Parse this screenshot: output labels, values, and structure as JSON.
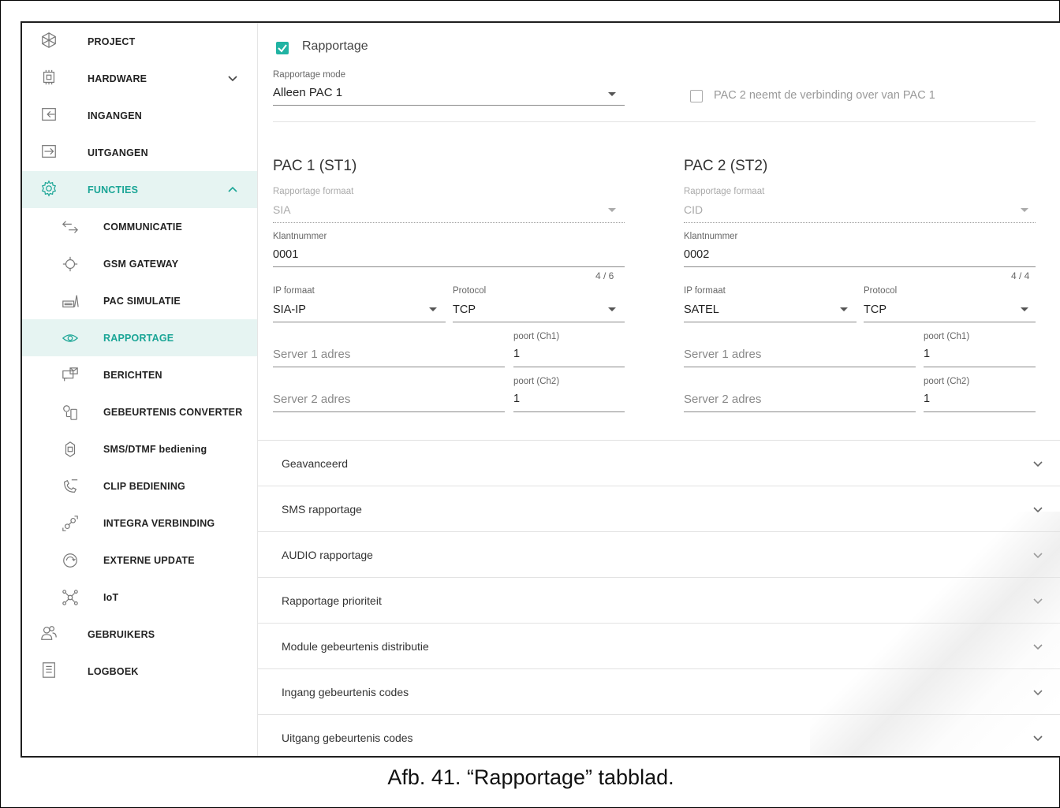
{
  "sidebar": {
    "items": [
      {
        "label": "PROJECT",
        "icon": "project-icon"
      },
      {
        "label": "HARDWARE",
        "icon": "hardware-icon",
        "chevron": "down"
      },
      {
        "label": "INGANGEN",
        "icon": "inputs-icon"
      },
      {
        "label": "UITGANGEN",
        "icon": "outputs-icon"
      },
      {
        "label": "FUNCTIES",
        "icon": "gear-icon",
        "chevron": "up"
      },
      {
        "label": "COMMUNICATIE",
        "icon": "communication-icon"
      },
      {
        "label": "GSM GATEWAY",
        "icon": "gsm-gateway-icon"
      },
      {
        "label": "PAC SIMULATIE",
        "icon": "pac-simulation-icon"
      },
      {
        "label": "RAPPORTAGE",
        "icon": "eye-icon"
      },
      {
        "label": "BERICHTEN",
        "icon": "messages-icon"
      },
      {
        "label": "GEBEURTENIS CONVERTER",
        "icon": "event-converter-icon"
      },
      {
        "label": "SMS/DTMF bediening",
        "icon": "sms-dtmf-icon"
      },
      {
        "label": "CLIP BEDIENING",
        "icon": "clip-phone-icon"
      },
      {
        "label": "INTEGRA VERBINDING",
        "icon": "integra-link-icon"
      },
      {
        "label": "EXTERNE UPDATE",
        "icon": "update-icon"
      },
      {
        "label": "IoT",
        "icon": "iot-icon"
      },
      {
        "label": "GEBRUIKERS",
        "icon": "users-icon"
      },
      {
        "label": "LOGBOEK",
        "icon": "log-icon"
      }
    ]
  },
  "main": {
    "reporting_checkbox_label": "Rapportage",
    "reporting_checked": true,
    "mode_label": "Rapportage mode",
    "mode_value": "Alleen PAC 1",
    "takeover_label": "PAC 2 neemt de verbinding over van PAC 1",
    "takeover_checked": false,
    "pac1": {
      "title": "PAC 1 (ST1)",
      "format_label": "Rapportage formaat",
      "format_value": "SIA",
      "client_label": "Klantnummer",
      "client_value": "0001",
      "client_counter": "4 / 6",
      "ip_format_label": "IP formaat",
      "ip_format_value": "SIA-IP",
      "protocol_label": "Protocol",
      "protocol_value": "TCP",
      "server1_placeholder": "Server 1 adres",
      "port1_label": "poort (Ch1)",
      "port1_value": "1",
      "server2_placeholder": "Server 2 adres",
      "port2_label": "poort (Ch2)",
      "port2_value": "1"
    },
    "pac2": {
      "title": "PAC 2 (ST2)",
      "format_label": "Rapportage formaat",
      "format_value": "CID",
      "client_label": "Klantnummer",
      "client_value": "0002",
      "client_counter": "4 / 4",
      "ip_format_label": "IP formaat",
      "ip_format_value": "SATEL",
      "protocol_label": "Protocol",
      "protocol_value": "TCP",
      "server1_placeholder": "Server 1 adres",
      "port1_label": "poort (Ch1)",
      "port1_value": "1",
      "server2_placeholder": "Server 2 adres",
      "port2_label": "poort (Ch2)",
      "port2_value": "1"
    },
    "accordions": [
      "Geavanceerd",
      "SMS rapportage",
      "AUDIO rapportage",
      "Rapportage prioriteit",
      "Module gebeurtenis distributie",
      "Ingang gebeurtenis codes",
      "Uitgang gebeurtenis codes"
    ]
  },
  "caption": "Afb. 41. “Rapportage” tabblad.",
  "colors": {
    "accent": "#21b3a3",
    "active_bg": "#e6f4f2"
  }
}
